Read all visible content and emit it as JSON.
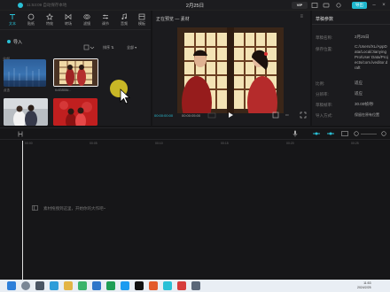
{
  "titlebar": {
    "status": "11:53:09 自动保存本地",
    "project_title": "2月25日",
    "vip_label": "VIP",
    "export_label": "导出"
  },
  "toolbar": {
    "tools": [
      {
        "label": "文本",
        "icon": "text-icon"
      },
      {
        "label": "贴纸",
        "icon": "sticker-icon"
      },
      {
        "label": "特效",
        "icon": "effects-icon"
      },
      {
        "label": "转场",
        "icon": "transition-icon"
      },
      {
        "label": "滤镜",
        "icon": "filter-icon"
      },
      {
        "label": "调节",
        "icon": "adjust-icon"
      },
      {
        "label": "音频",
        "icon": "audio-icon"
      },
      {
        "label": "模板",
        "icon": "template-icon"
      }
    ]
  },
  "media": {
    "import_label": "导入",
    "sort_label": "排序",
    "all_filter": "全部",
    "all_label": "全部",
    "items": [
      {
        "caption": "点击"
      },
      {
        "caption": "6c83858d..."
      },
      {
        "caption": ""
      },
      {
        "caption": ""
      }
    ]
  },
  "player": {
    "title": "正在预览 — 素材",
    "current_time": "00:00:00:00",
    "duration": "00:00:05:00"
  },
  "props": {
    "header": "草稿参数",
    "rows": [
      {
        "key": "草稿名称:",
        "value": "2月25日"
      },
      {
        "key": "保存位置:",
        "value": "C:/Users/XL/AppData/Local/JianyingPro/User Data/Projects/com.lveditor.draft"
      },
      {
        "key": "比例:",
        "value": "适应"
      },
      {
        "key": "分辨率:",
        "value": "适应"
      },
      {
        "key": "草稿帧率:",
        "value": "30.00帧/秒"
      },
      {
        "key": "导入方式:",
        "value": "保留在原有位置"
      }
    ]
  },
  "timeline": {
    "ticks": [
      "00:00",
      "00:05",
      "00:10",
      "00:15",
      "00:20",
      "00:25",
      "00:30"
    ],
    "hint": "素材拖拽到这里，开始你的大作吧~"
  },
  "taskbar": {
    "time": "11:53",
    "date": "2024/2/25"
  }
}
